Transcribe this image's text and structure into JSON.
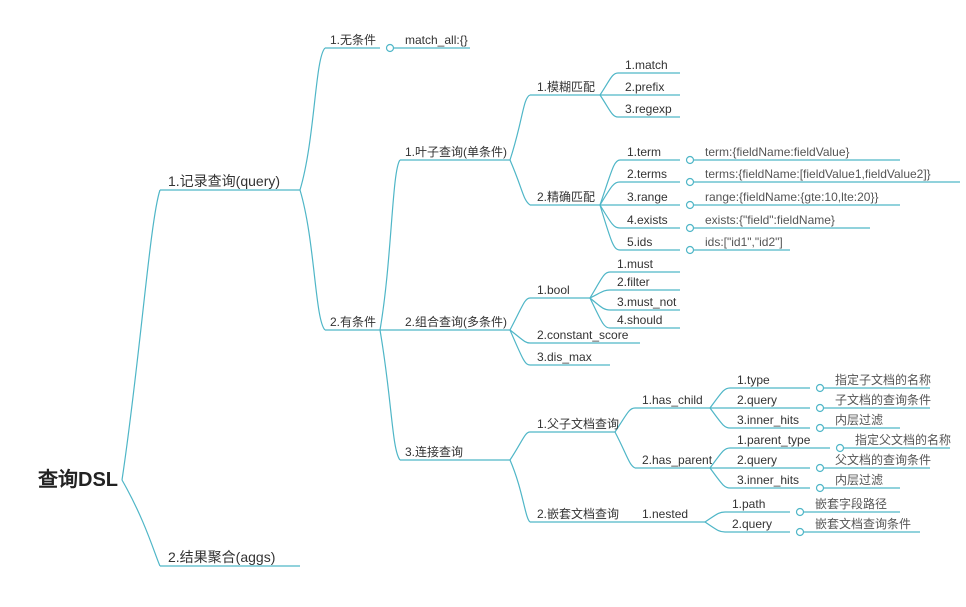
{
  "root": "查询DSL",
  "n1": "1.记录查询(query)",
  "n2": "2.结果聚合(aggs)",
  "n11": "1.无条件",
  "n11a": "match_all:{}",
  "n12": "2.有条件",
  "n121": "1.叶子查询(单条件)",
  "n1211": "1.模糊匹配",
  "n1211a": "1.match",
  "n1211b": "2.prefix",
  "n1211c": "3.regexp",
  "n1212": "2.精确匹配",
  "n1212a": "1.term",
  "n1212aD": "term:{fieldName:fieldValue}",
  "n1212b": "2.terms",
  "n1212bD": "terms:{fieldName:[fieldValue1,fieldValue2]}",
  "n1212c": "3.range",
  "n1212cD": "range:{fieldName:{gte:10,lte:20}}",
  "n1212d": "4.exists",
  "n1212dD": "exists:{\"field\":fieldName}",
  "n1212e": "5.ids",
  "n1212eD": "ids:[\"id1\",\"id2\"]",
  "n122": "2.组合查询(多条件)",
  "n1221": "1.bool",
  "n1221a": "1.must",
  "n1221b": "2.filter",
  "n1221c": "3.must_not",
  "n1221d": "4.should",
  "n1222": "2.constant_score",
  "n1223": "3.dis_max",
  "n123": "3.连接查询",
  "n1231": "1.父子文档查询",
  "n12311": "1.has_child",
  "n12311a": "1.type",
  "n12311aD": "指定子文档的名称",
  "n12311b": "2.query",
  "n12311bD": "子文档的查询条件",
  "n12311c": "3.inner_hits",
  "n12311cD": "内层过滤",
  "n12312": "2.has_parent",
  "n12312a": "1.parent_type",
  "n12312aD": "指定父文档的名称",
  "n12312b": "2.query",
  "n12312bD": "父文档的查询条件",
  "n12312c": "3.inner_hits",
  "n12312cD": "内层过滤",
  "n1232": "2.嵌套文档查询",
  "n12321": "1.nested",
  "n12321a": "1.path",
  "n12321aD": "嵌套字段路径",
  "n12321b": "2.query",
  "n12321bD": "嵌套文档查询条件"
}
